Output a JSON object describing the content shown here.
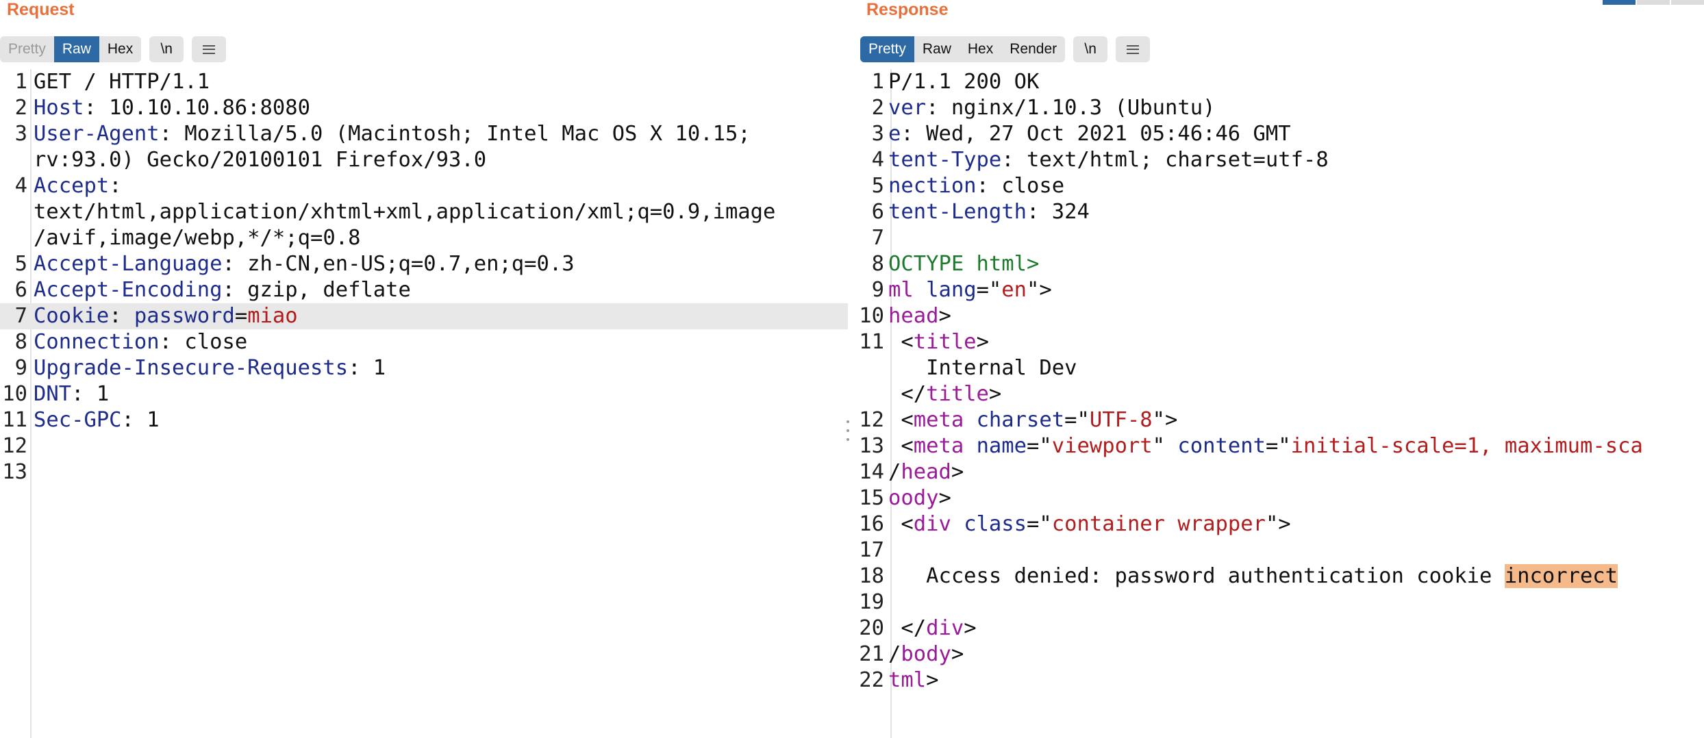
{
  "request": {
    "title": "Request",
    "tabs": [
      "Pretty",
      "Raw",
      "Hex"
    ],
    "newline_label": "\\n",
    "menu_icon": "hamburger-menu-icon",
    "lines": [
      {
        "n": "1",
        "parts": [
          {
            "t": "GET / HTTP/1.1",
            "c": ""
          }
        ]
      },
      {
        "n": "2",
        "parts": [
          {
            "t": "Host",
            "c": "k"
          },
          {
            "t": ": 10.10.10.86:8080",
            "c": ""
          }
        ]
      },
      {
        "n": "3",
        "parts": [
          {
            "t": "User-Agent",
            "c": "k"
          },
          {
            "t": ": Mozilla/5.0 (Macintosh; Intel Mac OS X 10.15;",
            "c": ""
          }
        ]
      },
      {
        "n": "",
        "parts": [
          {
            "t": "rv:93.0) Gecko/20100101 Firefox/93.0",
            "c": ""
          }
        ]
      },
      {
        "n": "4",
        "parts": [
          {
            "t": "Accept",
            "c": "k"
          },
          {
            "t": ":",
            "c": ""
          }
        ]
      },
      {
        "n": "",
        "parts": [
          {
            "t": "text/html,application/xhtml+xml,application/xml;q=0.9,image",
            "c": ""
          }
        ]
      },
      {
        "n": "",
        "parts": [
          {
            "t": "/avif,image/webp,*/*;q=0.8",
            "c": ""
          }
        ]
      },
      {
        "n": "5",
        "parts": [
          {
            "t": "Accept-Language",
            "c": "k"
          },
          {
            "t": ": zh-CN,en-US;q=0.7,en;q=0.3",
            "c": ""
          }
        ]
      },
      {
        "n": "6",
        "parts": [
          {
            "t": "Accept-Encoding",
            "c": "k"
          },
          {
            "t": ": gzip, deflate",
            "c": ""
          }
        ]
      },
      {
        "n": "7",
        "hl": true,
        "parts": [
          {
            "t": "Cookie",
            "c": "k"
          },
          {
            "t": ": ",
            "c": ""
          },
          {
            "t": "password",
            "c": "k"
          },
          {
            "t": "=",
            "c": ""
          },
          {
            "t": "miao",
            "c": "v"
          }
        ]
      },
      {
        "n": "8",
        "parts": [
          {
            "t": "Connection",
            "c": "k"
          },
          {
            "t": ": close",
            "c": ""
          }
        ]
      },
      {
        "n": "9",
        "parts": [
          {
            "t": "Upgrade-Insecure-Requests",
            "c": "k"
          },
          {
            "t": ": 1",
            "c": ""
          }
        ]
      },
      {
        "n": "10",
        "parts": [
          {
            "t": "DNT",
            "c": "k"
          },
          {
            "t": ": 1",
            "c": ""
          }
        ]
      },
      {
        "n": "11",
        "parts": [
          {
            "t": "Sec-GPC",
            "c": "k"
          },
          {
            "t": ": 1",
            "c": ""
          }
        ]
      },
      {
        "n": "12",
        "parts": []
      },
      {
        "n": "13",
        "parts": []
      }
    ]
  },
  "response": {
    "title": "Response",
    "tabs": [
      "Pretty",
      "Raw",
      "Hex",
      "Render"
    ],
    "newline_label": "\\n",
    "menu_icon": "hamburger-menu-icon",
    "lines": [
      {
        "n": "1",
        "parts": [
          {
            "t": "P/1.1 200 OK",
            "c": ""
          }
        ]
      },
      {
        "n": "2",
        "parts": [
          {
            "t": "ver",
            "c": "k"
          },
          {
            "t": ": nginx/1.10.3 (Ubuntu)",
            "c": ""
          }
        ]
      },
      {
        "n": "3",
        "parts": [
          {
            "t": "e",
            "c": "k"
          },
          {
            "t": ": Wed, 27 Oct 2021 05:46:46 GMT",
            "c": ""
          }
        ]
      },
      {
        "n": "4",
        "parts": [
          {
            "t": "tent-Type",
            "c": "k"
          },
          {
            "t": ": text/html; charset=utf-8",
            "c": ""
          }
        ]
      },
      {
        "n": "5",
        "parts": [
          {
            "t": "nection",
            "c": "k"
          },
          {
            "t": ": close",
            "c": ""
          }
        ]
      },
      {
        "n": "6",
        "parts": [
          {
            "t": "tent-Length",
            "c": "k"
          },
          {
            "t": ": 324",
            "c": ""
          }
        ]
      },
      {
        "n": "7",
        "parts": []
      },
      {
        "n": "8",
        "parts": [
          {
            "t": "OCTYPE html>",
            "c": "dt"
          }
        ]
      },
      {
        "n": "9",
        "parts": [
          {
            "t": "ml",
            "c": "tg"
          },
          {
            "t": " ",
            "c": ""
          },
          {
            "t": "lang",
            "c": "at"
          },
          {
            "t": "=\"",
            "c": ""
          },
          {
            "t": "en",
            "c": "v"
          },
          {
            "t": "\">",
            "c": ""
          }
        ]
      },
      {
        "n": "10",
        "parts": [
          {
            "t": "head",
            "c": "tg"
          },
          {
            "t": ">",
            "c": ""
          }
        ]
      },
      {
        "n": "11",
        "parts": [
          {
            "t": " <",
            "c": ""
          },
          {
            "t": "title",
            "c": "tg"
          },
          {
            "t": ">",
            "c": ""
          }
        ]
      },
      {
        "n": "",
        "parts": [
          {
            "t": "   Internal Dev",
            "c": ""
          }
        ]
      },
      {
        "n": "",
        "parts": [
          {
            "t": " </",
            "c": ""
          },
          {
            "t": "title",
            "c": "tg"
          },
          {
            "t": ">",
            "c": ""
          }
        ]
      },
      {
        "n": "12",
        "parts": [
          {
            "t": " <",
            "c": ""
          },
          {
            "t": "meta",
            "c": "tg"
          },
          {
            "t": " ",
            "c": ""
          },
          {
            "t": "charset",
            "c": "at"
          },
          {
            "t": "=\"",
            "c": ""
          },
          {
            "t": "UTF-8",
            "c": "v"
          },
          {
            "t": "\">",
            "c": ""
          }
        ]
      },
      {
        "n": "13",
        "parts": [
          {
            "t": " <",
            "c": ""
          },
          {
            "t": "meta",
            "c": "tg"
          },
          {
            "t": " ",
            "c": ""
          },
          {
            "t": "name",
            "c": "at"
          },
          {
            "t": "=\"",
            "c": ""
          },
          {
            "t": "viewport",
            "c": "v"
          },
          {
            "t": "\" ",
            "c": ""
          },
          {
            "t": "content",
            "c": "at"
          },
          {
            "t": "=\"",
            "c": ""
          },
          {
            "t": "initial-scale=1, maximum-sca",
            "c": "v"
          }
        ]
      },
      {
        "n": "14",
        "parts": [
          {
            "t": "/",
            "c": ""
          },
          {
            "t": "head",
            "c": "tg"
          },
          {
            "t": ">",
            "c": ""
          }
        ]
      },
      {
        "n": "15",
        "parts": [
          {
            "t": "oody",
            "c": "tg"
          },
          {
            "t": ">",
            "c": ""
          }
        ]
      },
      {
        "n": "16",
        "parts": [
          {
            "t": " <",
            "c": ""
          },
          {
            "t": "div",
            "c": "tg"
          },
          {
            "t": " ",
            "c": ""
          },
          {
            "t": "class",
            "c": "at"
          },
          {
            "t": "=\"",
            "c": ""
          },
          {
            "t": "container wrapper",
            "c": "v"
          },
          {
            "t": "\">",
            "c": ""
          }
        ]
      },
      {
        "n": "17",
        "parts": []
      },
      {
        "n": "18",
        "parts": [
          {
            "t": "   Access denied: password authentication cookie ",
            "c": ""
          },
          {
            "t": "incorrect",
            "c": "mark"
          }
        ]
      },
      {
        "n": "19",
        "parts": []
      },
      {
        "n": "20",
        "parts": [
          {
            "t": " </",
            "c": ""
          },
          {
            "t": "div",
            "c": "tg"
          },
          {
            "t": ">",
            "c": ""
          }
        ]
      },
      {
        "n": "21",
        "parts": [
          {
            "t": "/",
            "c": ""
          },
          {
            "t": "body",
            "c": "tg"
          },
          {
            "t": ">",
            "c": ""
          }
        ]
      },
      {
        "n": "22",
        "parts": [
          {
            "t": "tml",
            "c": "tg"
          },
          {
            "t": ">",
            "c": ""
          }
        ]
      }
    ]
  }
}
